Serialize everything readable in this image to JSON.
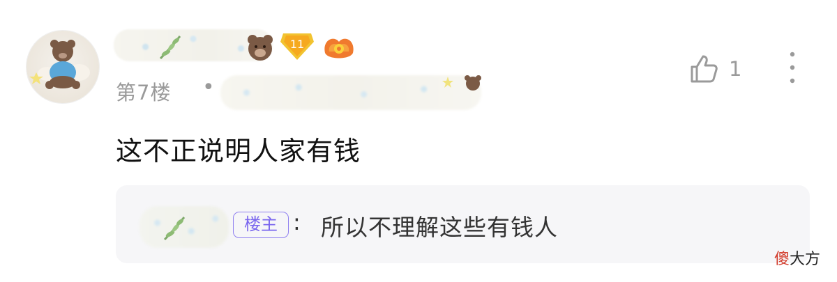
{
  "comment": {
    "floor_label": "第7楼",
    "separator": "•",
    "like_count": "1",
    "text": "这不正说明人家有钱",
    "level_badge": "11"
  },
  "quote": {
    "op_label": "楼主",
    "colon": ":",
    "text": "所以不理解这些有钱人"
  },
  "watermark": {
    "first_char": "傻",
    "rest": "大方"
  },
  "icons": {
    "like": "thumbs-up-icon",
    "more": "more-vertical-icon"
  },
  "colors": {
    "accent_purple": "#7a66ee",
    "muted_text": "#9a9a9a",
    "quote_bg": "#f6f6f8"
  }
}
